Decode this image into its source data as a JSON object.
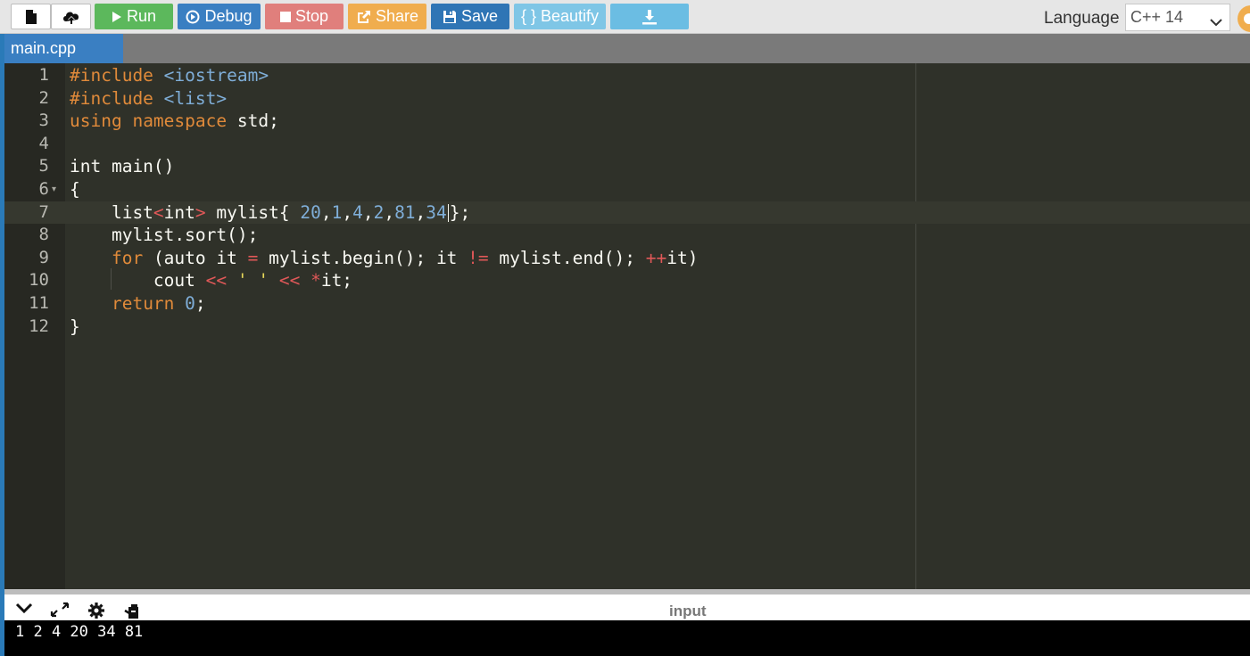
{
  "toolbar": {
    "run": "Run",
    "debug": "Debug",
    "stop": "Stop",
    "share": "Share",
    "save": "Save",
    "beautify": "{ } Beautify",
    "language_label": "Language",
    "language_value": "C++ 14"
  },
  "tabs": {
    "file": "main.cpp"
  },
  "editor": {
    "active_line": 7,
    "line_numbers": [
      "1",
      "2",
      "3",
      "4",
      "5",
      "6",
      "7",
      "8",
      "9",
      "10",
      "11",
      "12"
    ]
  },
  "output": {
    "label": "input",
    "console_text": "1 2 4 20 34 81"
  },
  "colors": {
    "run": "#5cb85c",
    "debug": "#3a7fc2",
    "stop": "#e07f7c",
    "share": "#f0ad4e",
    "save": "#2f75b5",
    "beautify": "#7fc6e6",
    "editor_bg": "#2f3129",
    "keyword": "#e08a3a",
    "literal": "#7faed8"
  }
}
